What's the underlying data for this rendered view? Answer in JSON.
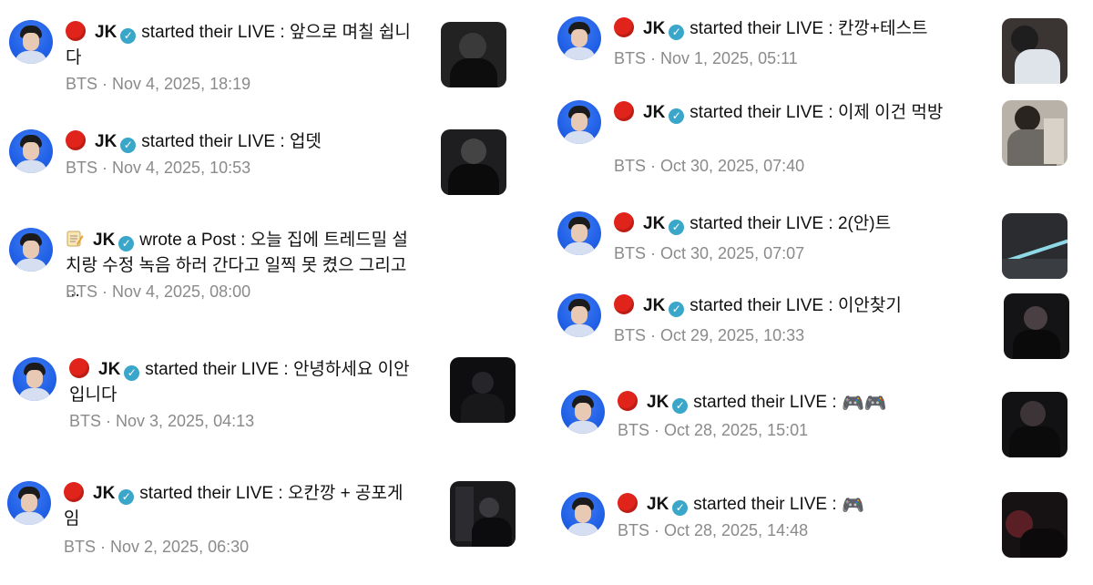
{
  "left": [
    {
      "name": "JK",
      "action": "started their LIVE :",
      "text": "앞으로 며칠 쉽니다",
      "meta": "BTS · Nov 4, 2025, 18:19",
      "icon": "live-dot-icon"
    },
    {
      "name": "JK",
      "action": "started their LIVE :",
      "text": "업뎃",
      "meta": "BTS · Nov 4, 2025, 10:53",
      "icon": "live-dot-icon"
    },
    {
      "name": "JK",
      "action": "wrote a Post :",
      "text": "오늘 집에 트레드밀 설치랑 수정 녹음 하러 간다고 일찍 못 켰으 그리고 ...",
      "meta": "BTS · Nov 4, 2025, 08:00",
      "icon": "memo-icon"
    },
    {
      "name": "JK",
      "action": "started their LIVE :",
      "text": "안녕하세요 이안입니다",
      "meta": "BTS · Nov 3, 2025, 04:13",
      "icon": "live-dot-icon"
    },
    {
      "name": "JK",
      "action": "started their LIVE :",
      "text": "오칸깡 + 공포게임",
      "meta": "BTS · Nov 2, 2025, 06:30",
      "icon": "live-dot-icon"
    }
  ],
  "right": [
    {
      "name": "JK",
      "action": "started their LIVE :",
      "text": "칸깡+테스트",
      "meta": "BTS · Nov 1, 2025, 05:11",
      "icon": "live-dot-icon"
    },
    {
      "name": "JK",
      "action": "started their LIVE :",
      "text": "이제 이건 먹방",
      "meta": "BTS · Oct 30, 2025, 07:40",
      "icon": "live-dot-icon"
    },
    {
      "name": "JK",
      "action": "started their LIVE :",
      "text": "2(안)트",
      "meta": "BTS · Oct 30, 2025, 07:07",
      "icon": "live-dot-icon"
    },
    {
      "name": "JK",
      "action": "started their LIVE :",
      "text": "이안찾기",
      "meta": "BTS · Oct 29, 2025, 10:33",
      "icon": "live-dot-icon"
    },
    {
      "name": "JK",
      "action": "started their LIVE :",
      "text": "🎮🎮",
      "meta": "BTS · Oct 28, 2025, 15:01",
      "icon": "live-dot-icon"
    },
    {
      "name": "JK",
      "action": "started their LIVE :",
      "text": "🎮",
      "meta": "BTS · Oct 28, 2025, 14:48",
      "icon": "live-dot-icon"
    }
  ],
  "verified_symbol": "✓",
  "colors": {
    "live": "#e0231b",
    "verified": "#3aa6c9",
    "meta": "#8a8a8a",
    "avatar": "#2161e7"
  }
}
